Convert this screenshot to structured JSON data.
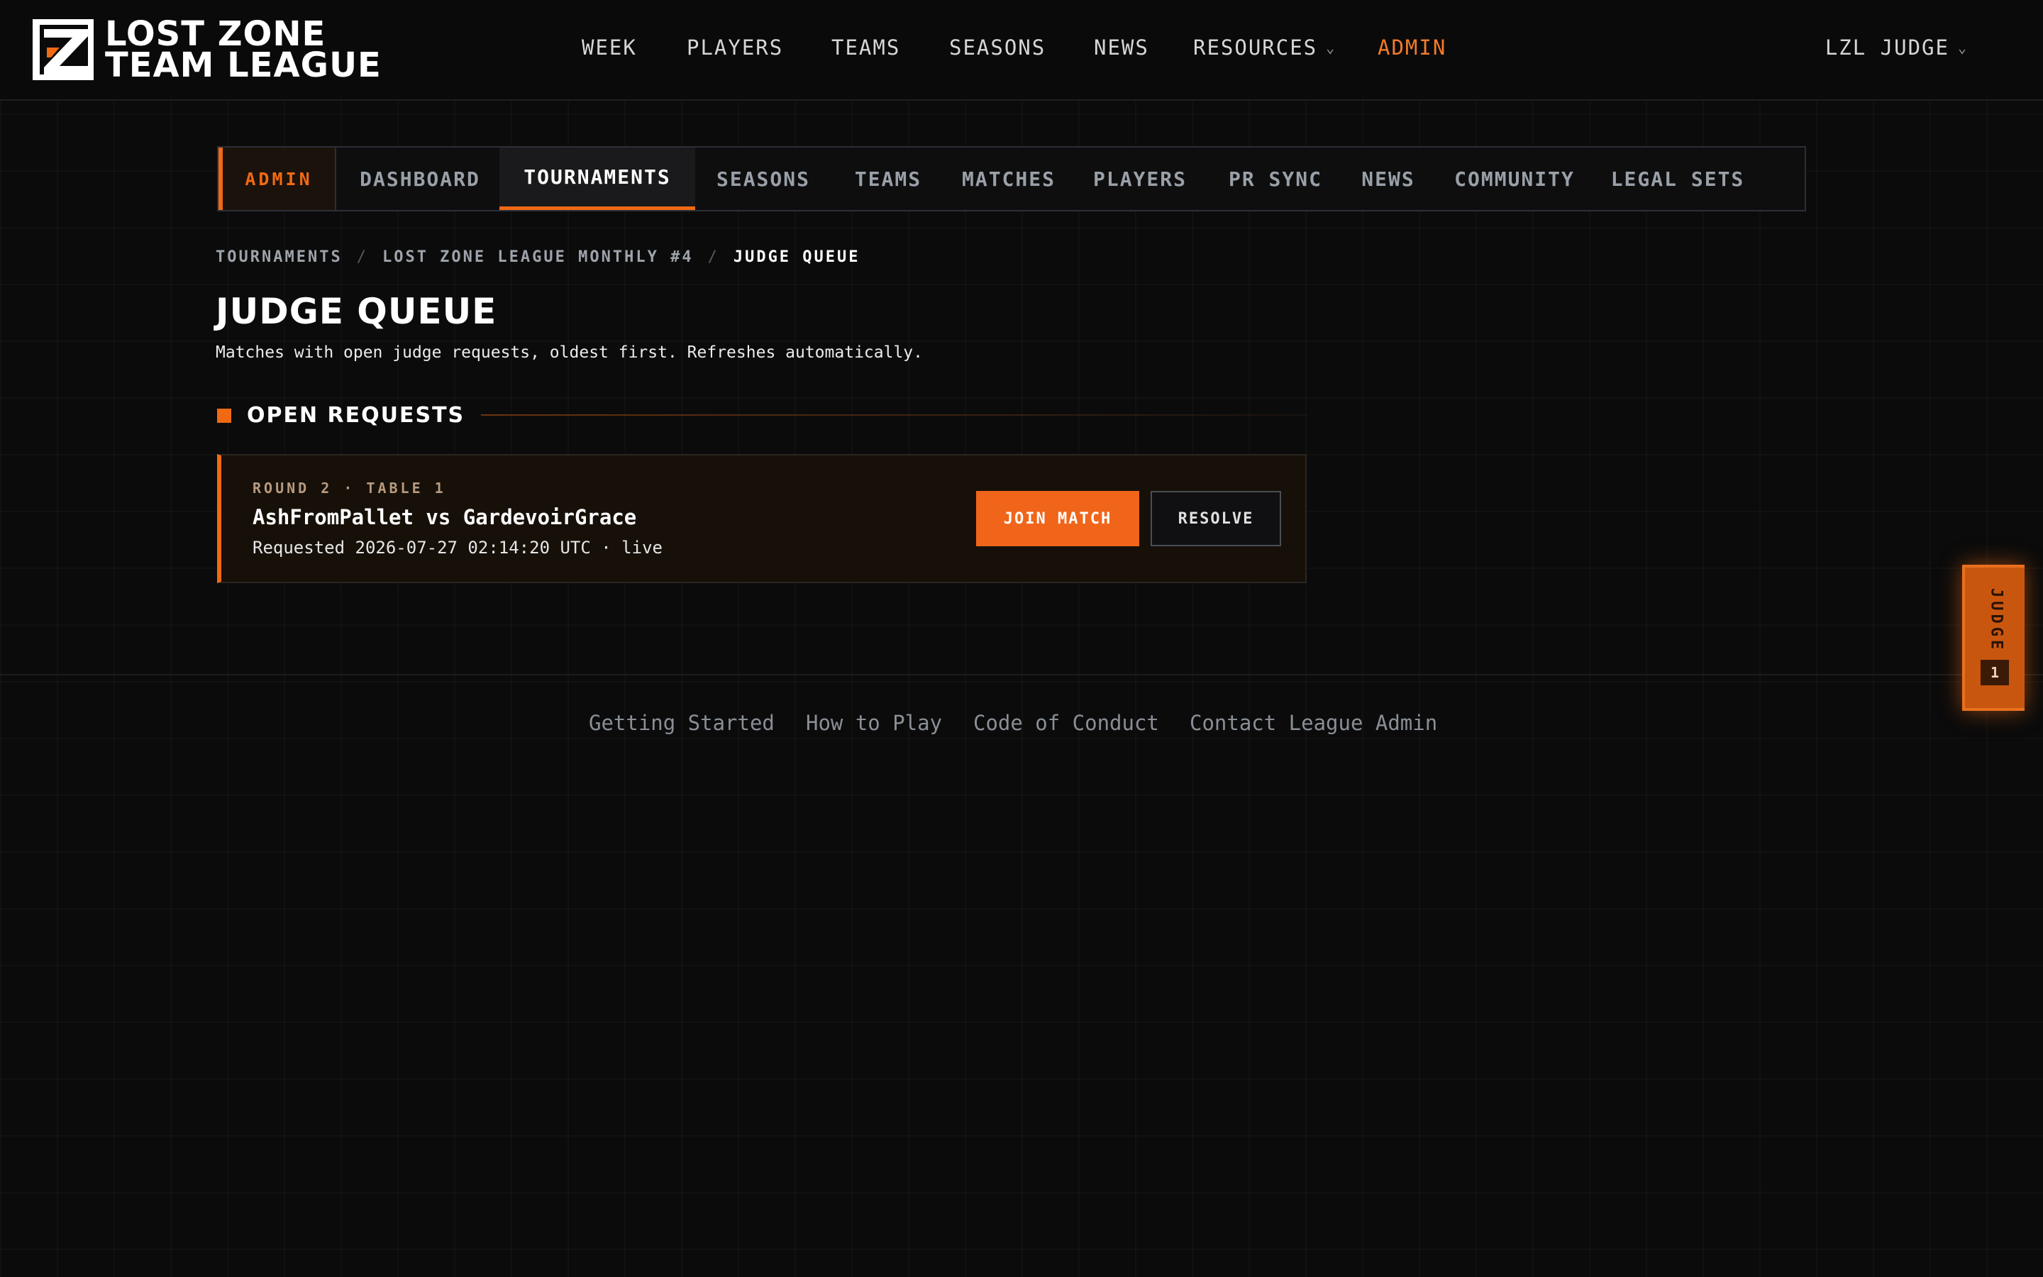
{
  "header": {
    "brand_line1": "LOST ZONE",
    "brand_line2": "TEAM LEAGUE",
    "nav": {
      "week": "WEEK",
      "players": "PLAYERS",
      "teams": "TEAMS",
      "seasons": "SEASONS",
      "news": "NEWS",
      "resources": "RESOURCES",
      "admin": "ADMIN"
    },
    "user": "LZL JUDGE"
  },
  "admin_tabs": {
    "badge": "ADMIN",
    "items": [
      "DASHBOARD",
      "TOURNAMENTS",
      "SEASONS",
      "TEAMS",
      "MATCHES",
      "PLAYERS",
      "PR SYNC",
      "NEWS",
      "COMMUNITY",
      "LEGAL SETS"
    ],
    "active": "TOURNAMENTS"
  },
  "breadcrumb": [
    "TOURNAMENTS",
    "LOST ZONE LEAGUE MONTHLY #4",
    "JUDGE QUEUE"
  ],
  "page": {
    "title": "JUDGE QUEUE",
    "subtitle": "Matches with open judge requests, oldest first. Refreshes automatically."
  },
  "section": {
    "title": "OPEN REQUESTS"
  },
  "requests": [
    {
      "meta": "ROUND 2 · TABLE 1",
      "players": "AshFromPallet vs GardevoirGrace",
      "requested": "Requested 2026-07-27 02:14:20 UTC · live",
      "join_label": "JOIN MATCH",
      "resolve_label": "RESOLVE"
    }
  ],
  "footer": {
    "links": [
      "Getting Started",
      "How to Play",
      "Code of Conduct",
      "Contact League Admin"
    ]
  },
  "judge_tab": {
    "label": "JUDGE",
    "count": "1"
  },
  "colors": {
    "accent": "#f06a14",
    "background": "#0b0b0b",
    "text": "#ffffff",
    "muted": "#9aa0a8"
  }
}
